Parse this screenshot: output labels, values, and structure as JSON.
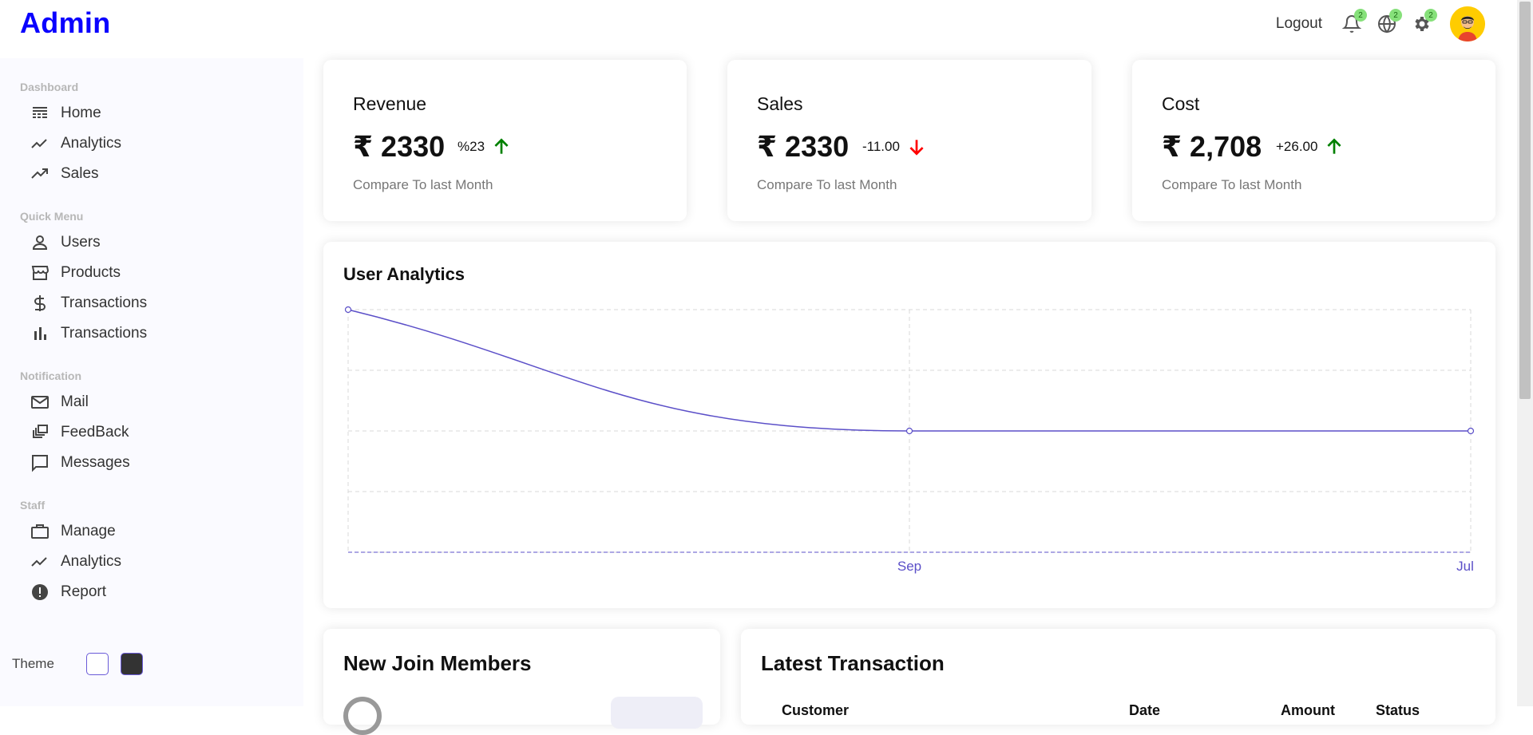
{
  "app": {
    "title": "Admin"
  },
  "topbar": {
    "logout_label": "Logout",
    "icons": [
      {
        "name": "bell-icon",
        "badge": "2"
      },
      {
        "name": "globe-icon",
        "badge": "2"
      },
      {
        "name": "gear-icon",
        "badge": "2"
      }
    ],
    "avatar": "avatar"
  },
  "sidebar": {
    "sections": [
      {
        "title": "Dashboard",
        "items": [
          {
            "label": "Home",
            "icon": "home-icon"
          },
          {
            "label": "Analytics",
            "icon": "timeline-icon"
          },
          {
            "label": "Sales",
            "icon": "trending-up-icon"
          }
        ]
      },
      {
        "title": "Quick Menu",
        "items": [
          {
            "label": "Users",
            "icon": "user-icon"
          },
          {
            "label": "Products",
            "icon": "storefront-icon"
          },
          {
            "label": "Transactions",
            "icon": "dollar-icon"
          },
          {
            "label": "Transactions",
            "icon": "bar-chart-icon"
          }
        ]
      },
      {
        "title": "Notification",
        "items": [
          {
            "label": "Mail",
            "icon": "mail-icon"
          },
          {
            "label": "FeedBack",
            "icon": "dynamic-feed-icon"
          },
          {
            "label": "Messages",
            "icon": "chat-bubble-icon"
          }
        ]
      },
      {
        "title": "Staff",
        "items": [
          {
            "label": "Manage",
            "icon": "work-icon"
          },
          {
            "label": "Analytics",
            "icon": "timeline-icon"
          },
          {
            "label": "Report",
            "icon": "report-icon"
          }
        ]
      }
    ],
    "theme_label": "Theme"
  },
  "featured": [
    {
      "title": "Revenue",
      "value": "₹ 2330",
      "rate": "%23",
      "direction": "up",
      "subtitle": "Compare To last Month"
    },
    {
      "title": "Sales",
      "value": "₹ 2330",
      "rate": "-11.00",
      "direction": "down",
      "subtitle": "Compare To last Month"
    },
    {
      "title": "Cost",
      "value": "₹ 2,708",
      "rate": "+26.00",
      "direction": "up",
      "subtitle": "Compare To last Month"
    }
  ],
  "colors": {
    "accent": "#0a00ff",
    "line": "#5b4fc8",
    "up": "#008000",
    "down": "#ff0000"
  },
  "chart_data": {
    "type": "line",
    "title": "User Analytics",
    "x": [
      "",
      "Sep",
      "Jul"
    ],
    "series": [
      {
        "values": [
          4,
          2,
          2
        ]
      }
    ],
    "ylim": [
      0,
      4
    ],
    "grid": true
  },
  "widgets": {
    "members_title": "New Join Members",
    "transactions_title": "Latest Transaction",
    "columns": [
      "Customer",
      "Date",
      "Amount",
      "Status"
    ]
  }
}
